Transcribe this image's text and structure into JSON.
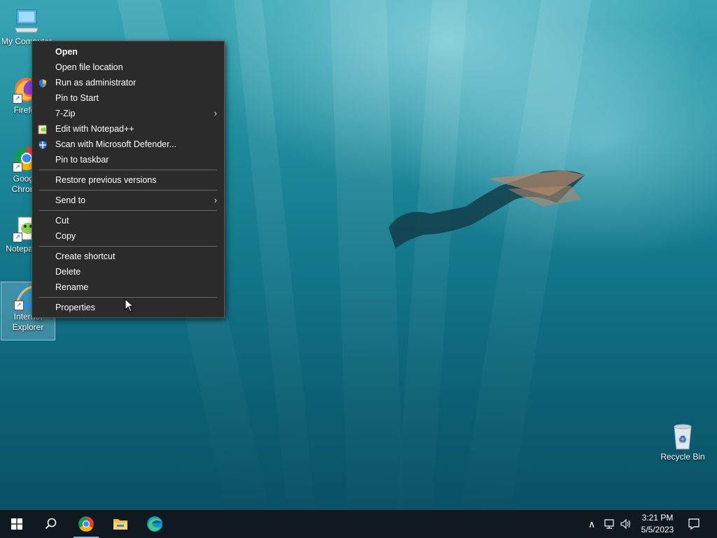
{
  "desktop": {
    "icons": [
      {
        "label": "My Computer",
        "icon": "computer-icon"
      },
      {
        "label": "Firefox",
        "icon": "firefox-icon"
      },
      {
        "label": "Google Chrome",
        "icon": "chrome-icon"
      },
      {
        "label": "Notepad++",
        "icon": "notepadpp-icon"
      },
      {
        "label": "Internet Explorer",
        "icon": "internet-explorer-icon",
        "selected": true
      },
      {
        "label": "Recycle Bin",
        "icon": "recycle-bin-icon"
      }
    ]
  },
  "context_menu": {
    "items": [
      {
        "label": "Open",
        "bold": true
      },
      {
        "label": "Open file location"
      },
      {
        "label": "Run as administrator",
        "icon": "uac-shield-icon"
      },
      {
        "label": "Pin to Start"
      },
      {
        "label": "7-Zip",
        "submenu": true
      },
      {
        "label": "Edit with Notepad++",
        "icon": "notepadpp-icon"
      },
      {
        "label": "Scan with Microsoft Defender...",
        "icon": "defender-icon"
      },
      {
        "label": "Pin to taskbar"
      },
      {
        "label": "Restore previous versions"
      },
      {
        "label": "Send to",
        "submenu": true
      },
      {
        "label": "Cut"
      },
      {
        "label": "Copy"
      },
      {
        "label": "Create shortcut"
      },
      {
        "label": "Delete"
      },
      {
        "label": "Rename"
      },
      {
        "label": "Properties"
      }
    ]
  },
  "taskbar": {
    "buttons": [
      {
        "name": "start",
        "icon": "windows-logo-icon"
      },
      {
        "name": "search",
        "icon": "search-icon"
      },
      {
        "name": "chrome",
        "icon": "chrome-icon",
        "active": true
      },
      {
        "name": "file-explorer",
        "icon": "folder-icon"
      },
      {
        "name": "edge",
        "icon": "edge-icon"
      }
    ],
    "clock": {
      "time": "3:21 PM",
      "date": "5/5/2023"
    },
    "tray_icons": [
      "chevron-up-icon",
      "network-icon",
      "volume-icon",
      "notification-icon"
    ]
  },
  "colors": {
    "menu_bg": "#2b2b2b",
    "taskbar_bg": "#101820",
    "selection": "#7fb6e8"
  }
}
